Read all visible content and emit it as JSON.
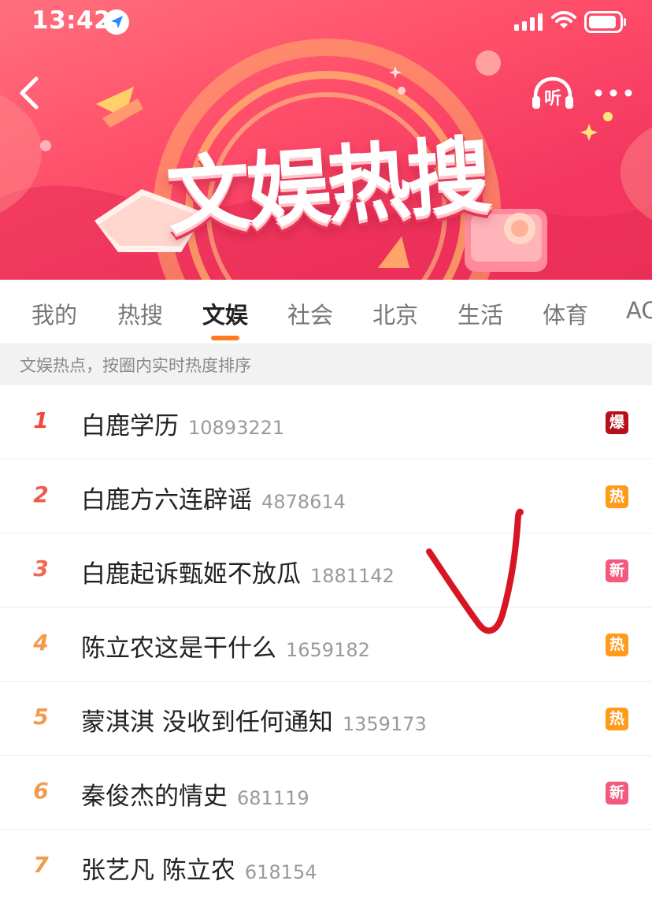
{
  "status_bar": {
    "time": "13:42"
  },
  "header": {
    "title": "文娱热搜",
    "listen_label": "听"
  },
  "tabs": [
    {
      "label": "我的"
    },
    {
      "label": "热搜"
    },
    {
      "label": "文娱",
      "active": true
    },
    {
      "label": "社会"
    },
    {
      "label": "北京"
    },
    {
      "label": "生活"
    },
    {
      "label": "体育"
    },
    {
      "label": "AC"
    }
  ],
  "hint": "文娱热点，按圈内实时热度排序",
  "list": [
    {
      "rank": "1",
      "title": "白鹿学历",
      "count": "10893221",
      "badge": "爆"
    },
    {
      "rank": "2",
      "title": "白鹿方六连辟谣",
      "count": "4878614",
      "badge": "热"
    },
    {
      "rank": "3",
      "title": "白鹿起诉甄姬不放瓜",
      "count": "1881142",
      "badge": "新"
    },
    {
      "rank": "4",
      "title": "陈立农这是干什么",
      "count": "1659182",
      "badge": "热"
    },
    {
      "rank": "5",
      "title": "蒙淇淇 没收到任何通知",
      "count": "1359173",
      "badge": "热"
    },
    {
      "rank": "6",
      "title": "秦俊杰的情史",
      "count": "681119",
      "badge": "新"
    },
    {
      "rank": "7",
      "title": "张艺凡 陈立农",
      "count": "618154",
      "badge": ""
    }
  ],
  "colors": {
    "accent": "#ff7a1f",
    "rank_1": "#f04a3f",
    "rank_2": "#ef5a4a",
    "rank_3": "#ef6a55",
    "rank_other": "#f29b4b",
    "badge_bao": "#b8101a",
    "badge_re": "#ff9a1a",
    "badge_xin": "#f25a7d",
    "annotation_mark": "#d81524"
  }
}
